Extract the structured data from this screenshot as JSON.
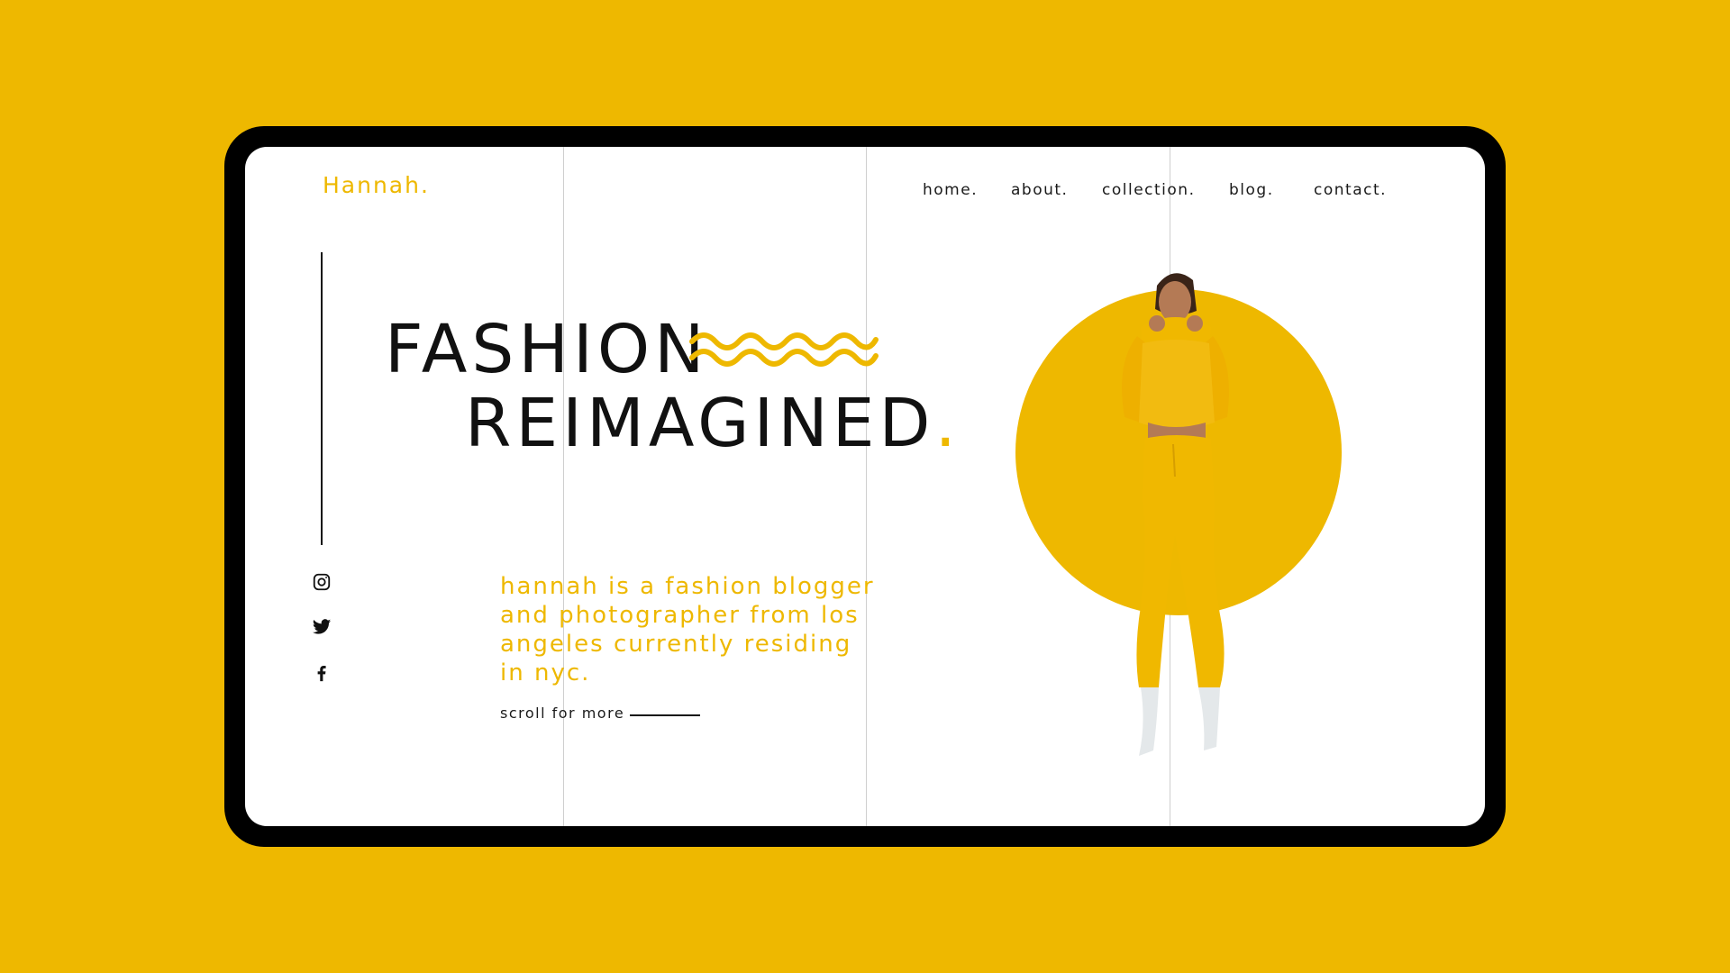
{
  "brand": {
    "logo": "Hannah."
  },
  "nav": {
    "items": [
      {
        "label": "home."
      },
      {
        "label": "about."
      },
      {
        "label": "collection."
      },
      {
        "label": "blog."
      },
      {
        "label": "contact."
      }
    ]
  },
  "hero": {
    "line1": "FASHION",
    "line2": "REIMAGINED",
    "line2_dot": ".",
    "tagline": "hannah is a fashion blogger and photographer from los angeles currently residing in nyc.",
    "scroll_label": "scroll for more"
  },
  "social": {
    "icons": [
      "instagram-icon",
      "twitter-icon",
      "facebook-icon"
    ]
  },
  "colors": {
    "accent": "#EEB800",
    "frame": "#000000",
    "screen": "#FFFFFF",
    "text": "#111111"
  }
}
